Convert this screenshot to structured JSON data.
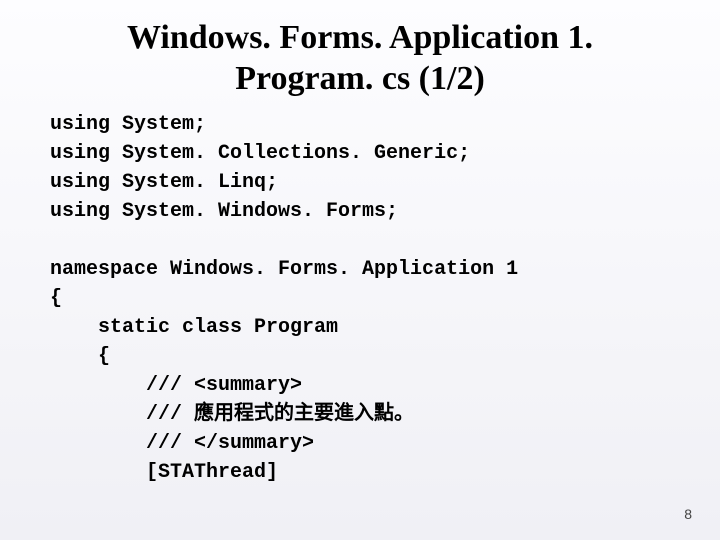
{
  "title_line1": "Windows. Forms. Application 1.",
  "title_line2": "Program. cs (1/2)",
  "code_lines": [
    "using System;",
    "using System. Collections. Generic;",
    "using System. Linq;",
    "using System. Windows. Forms;",
    "",
    "namespace Windows. Forms. Application 1",
    "{",
    "    static class Program",
    "    {",
    "        /// <summary>",
    "        /// 應用程式的主要進入點。",
    "        /// </summary>",
    "        [STAThread]"
  ],
  "page_number": "8"
}
